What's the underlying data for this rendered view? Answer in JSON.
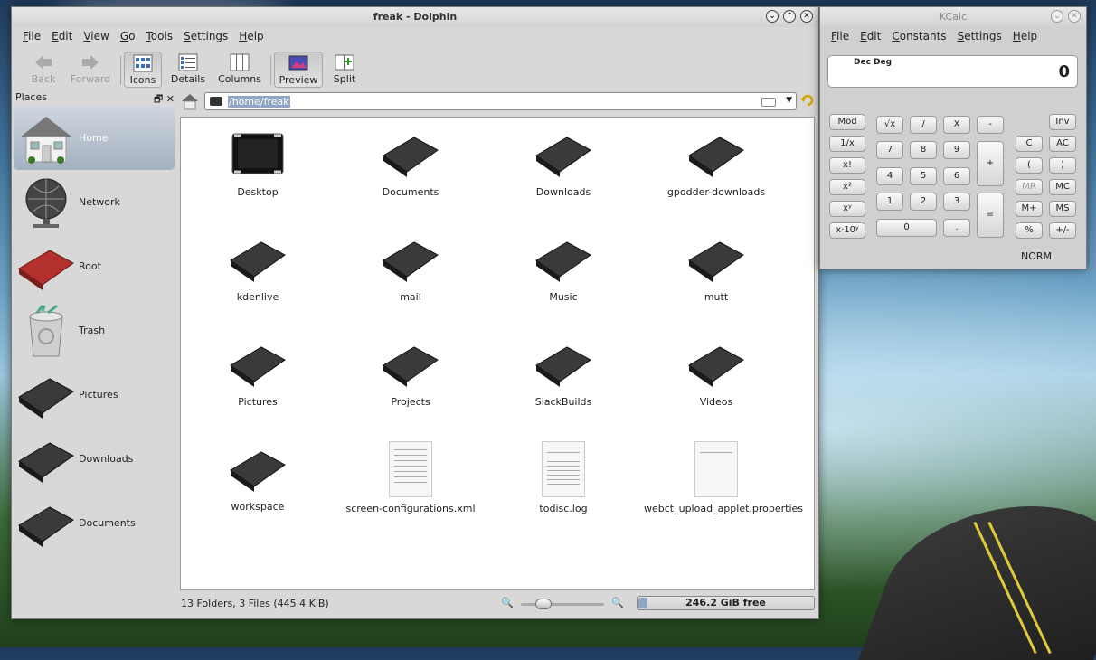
{
  "dolphin": {
    "title": "freak - Dolphin",
    "menu": [
      "File",
      "Edit",
      "View",
      "Go",
      "Tools",
      "Settings",
      "Help"
    ],
    "toolbar": {
      "back": "Back",
      "forward": "Forward",
      "icons": "Icons",
      "details": "Details",
      "columns": "Columns",
      "preview": "Preview",
      "split": "Split"
    },
    "places_title": "Places",
    "places": [
      "Home",
      "Network",
      "Root",
      "Trash",
      "Pictures",
      "Downloads",
      "Documents"
    ],
    "path": "/home/freak",
    "items": [
      "Desktop",
      "Documents",
      "Downloads",
      "gpodder-downloads",
      "kdenlive",
      "mail",
      "Music",
      "mutt",
      "Pictures",
      "Projects",
      "SlackBuilds",
      "Videos",
      "workspace",
      "screen-configurations.xml",
      "todisc.log",
      "webct_upload_applet.properties"
    ],
    "status": "13 Folders, 3 Files (445.4 KiB)",
    "free_space": "246.2 GiB free"
  },
  "kcalc": {
    "title": "KCalc",
    "menu": [
      "File",
      "Edit",
      "Constants",
      "Settings",
      "Help"
    ],
    "flags": "Dec  Deg",
    "display_value": "0",
    "buttons": {
      "mod": "Mod",
      "inv_x": "1/x",
      "fact": "x!",
      "sq": "x²",
      "pow": "xʸ",
      "exp": "x·10ʸ",
      "sqrt": "√x",
      "div": "/",
      "mul": "X",
      "sub": "-",
      "n7": "7",
      "n8": "8",
      "n9": "9",
      "add": "+",
      "n4": "4",
      "n5": "5",
      "n6": "6",
      "n1": "1",
      "n2": "2",
      "n3": "3",
      "eq": "=",
      "n0": "0",
      "dot": ".",
      "inv": "Inv",
      "c": "C",
      "ac": "AC",
      "lp": "(",
      "rp": ")",
      "mr": "MR",
      "mc": "MC",
      "mplus": "M+",
      "ms": "MS",
      "pct": "%",
      "neg": "+/-"
    },
    "mode": "NORM"
  }
}
